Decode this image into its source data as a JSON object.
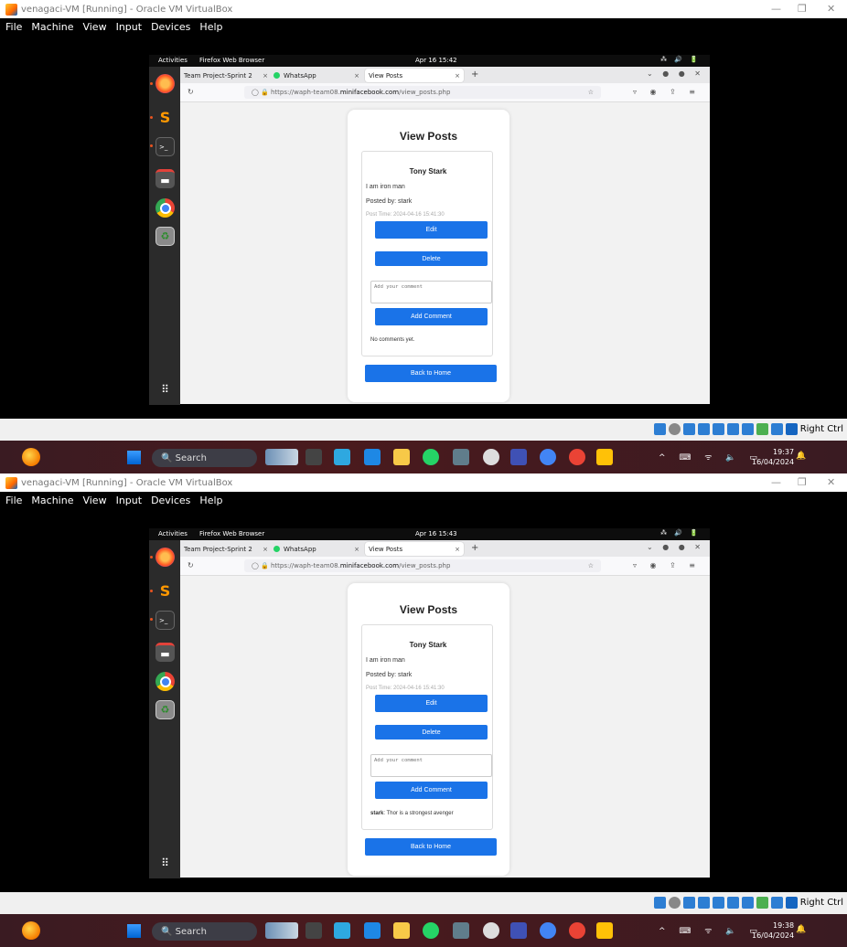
{
  "window_title": "venagaci-VM [Running] - Oracle VM VirtualBox",
  "window_controls": [
    "—",
    "❐",
    "✕"
  ],
  "menubar": [
    "File",
    "Machine",
    "View",
    "Input",
    "Devices",
    "Help"
  ],
  "gnome": {
    "activities": "Activities",
    "app_name": "Firefox Web Browser",
    "tray": "⁂ 🔊 🔋"
  },
  "browser": {
    "tabs": [
      "Team Project-Sprint 2",
      "WhatsApp",
      "View Posts"
    ],
    "url_prefix": "https://waph-team08.",
    "url_domain": "minifacebook.com",
    "url_path": "/view_posts.php"
  },
  "page": {
    "title": "View Posts",
    "post": {
      "author": "Tony Stark",
      "content": "I am iron man",
      "posted_by": "Posted by: stark",
      "time": "Post Time: 2024-04-16 15:41:30"
    },
    "edit_label": "Edit",
    "delete_label": "Delete",
    "comment_placeholder": "Add your comment",
    "add_comment_label": "Add Comment",
    "back_label": "Back to Home"
  },
  "shots": [
    {
      "gnome_clock": "Apr 16 15:42",
      "comments_text": "No comments yet.",
      "comment_author": "",
      "host_time": "19:37",
      "host_date": "16/04/2024"
    },
    {
      "gnome_clock": "Apr 16 15:43",
      "comments_text": ": Thor is a strongest avenger",
      "comment_author": "stark",
      "host_time": "19:38",
      "host_date": "16/04/2024"
    }
  ],
  "host_tray_label": "Right Ctrl",
  "taskbar": {
    "search_label": "Search",
    "tray_icons": "^ ⌨ ᯤ 🔈 ▭",
    "bell": "🔔"
  }
}
